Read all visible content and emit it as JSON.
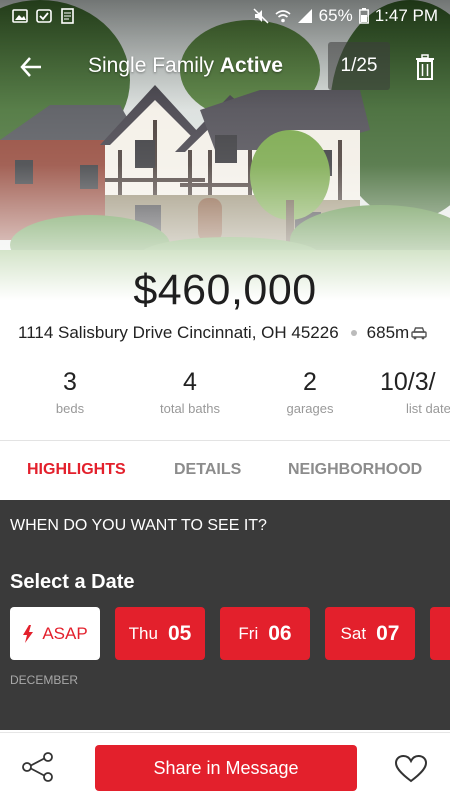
{
  "status_bar": {
    "battery": "65%",
    "time": "1:47 PM",
    "icons": [
      "image-icon",
      "check-square-icon",
      "document-icon",
      "mute-icon",
      "wifi-icon",
      "signal-icon",
      "battery-icon"
    ]
  },
  "header": {
    "title_prefix": "Single Family",
    "title_status": "Active",
    "photo_counter": "1/25",
    "back_icon": "back-arrow-icon",
    "delete_icon": "trash-icon"
  },
  "listing": {
    "price": "$460,000",
    "address": "1114 Salisbury Drive Cincinnati, OH 45226",
    "distance": "685m",
    "distance_icon": "car-icon"
  },
  "stats": [
    {
      "value": "3",
      "label": "beds"
    },
    {
      "value": "4",
      "label": "total baths"
    },
    {
      "value": "2",
      "label": "garages"
    },
    {
      "value": "10/3/",
      "label": "list date"
    }
  ],
  "tabs": [
    {
      "label": "HIGHLIGHTS",
      "active": true
    },
    {
      "label": "DETAILS",
      "active": false
    },
    {
      "label": "NEIGHBORHOOD",
      "active": false
    }
  ],
  "schedule": {
    "question": "WHEN DO YOU WANT TO SEE IT?",
    "title": "Select a Date",
    "asap_label": "ASAP",
    "asap_icon": "lightning-icon",
    "dates": [
      {
        "dow": "Thu",
        "day": "05"
      },
      {
        "dow": "Fri",
        "day": "06"
      },
      {
        "dow": "Sat",
        "day": "07"
      }
    ],
    "month": "DECEMBER"
  },
  "bottom_bar": {
    "share_label": "Share in Message",
    "share_icon": "share-icon",
    "favorite_icon": "heart-icon"
  },
  "colors": {
    "accent": "#e3202c",
    "dark_section": "#3a3a3a"
  }
}
